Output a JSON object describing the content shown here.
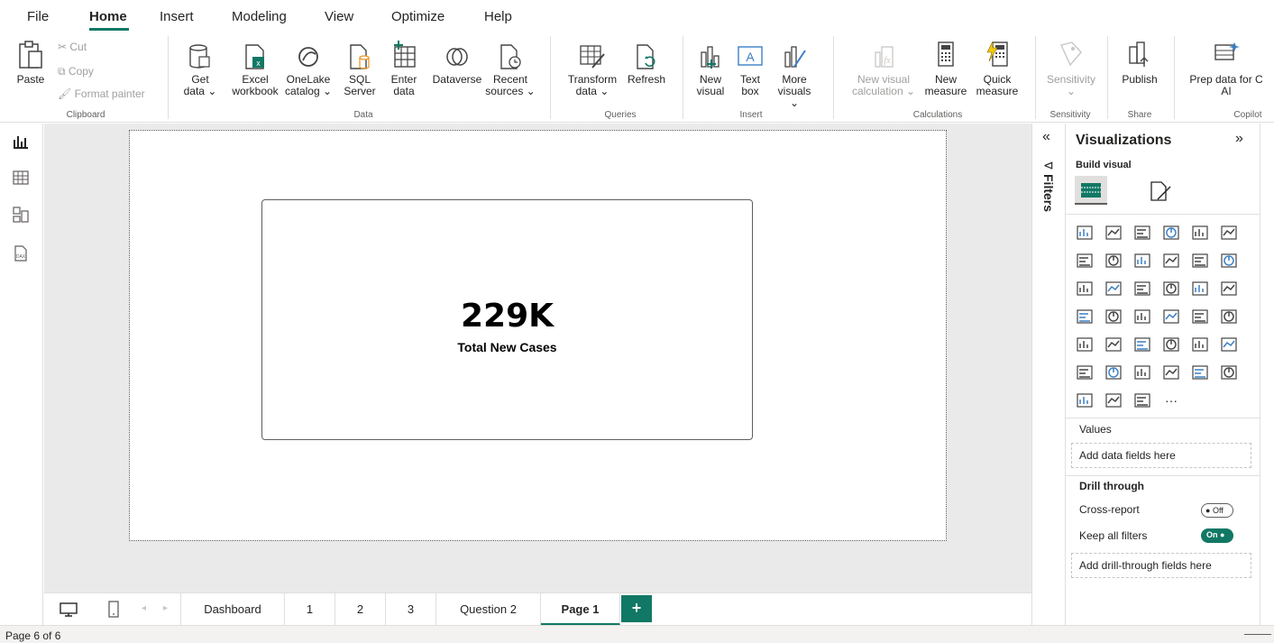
{
  "menu": {
    "items": [
      "File",
      "Home",
      "Insert",
      "Modeling",
      "View",
      "Optimize",
      "Help"
    ],
    "active": "Home"
  },
  "ribbon": {
    "clipboard": {
      "paste": "Paste",
      "cut": "Cut",
      "copy": "Copy",
      "format_painter": "Format painter",
      "group": "Clipboard"
    },
    "data": {
      "group": "Data",
      "get_data": [
        "Get",
        "data ⌄"
      ],
      "excel": [
        "Excel",
        "workbook"
      ],
      "onelake": [
        "OneLake",
        "catalog ⌄"
      ],
      "sql": [
        "SQL",
        "Server"
      ],
      "enter": [
        "Enter",
        "data"
      ],
      "dataverse": [
        "Dataverse",
        ""
      ],
      "recent": [
        "Recent",
        "sources ⌄"
      ]
    },
    "queries": {
      "group": "Queries",
      "transform": [
        "Transform",
        "data ⌄"
      ],
      "refresh": [
        "Refresh",
        ""
      ]
    },
    "insert": {
      "group": "Insert",
      "new_visual": [
        "New",
        "visual"
      ],
      "text_box": [
        "Text",
        "box"
      ],
      "more_visuals": [
        "More",
        "visuals ⌄"
      ]
    },
    "calculations": {
      "group": "Calculations",
      "new_visual_calc": [
        "New visual",
        "calculation ⌄"
      ],
      "new_measure": [
        "New",
        "measure"
      ],
      "quick_measure": [
        "Quick",
        "measure"
      ]
    },
    "sensitivity": {
      "group": "Sensitivity",
      "label": [
        "Sensitivity",
        "⌄"
      ]
    },
    "share": {
      "group": "Share",
      "publish": [
        "Publish",
        ""
      ]
    },
    "copilot": {
      "group": "Copilot",
      "prep": [
        "Prep data for C",
        "AI"
      ]
    }
  },
  "card": {
    "value": "229K",
    "label": "Total New Cases"
  },
  "tabs": [
    "Dashboard",
    "1",
    "2",
    "3",
    "Question 2",
    "Page 1"
  ],
  "active_tab": "Page 1",
  "add_page": "+",
  "status": "Page 6 of 6",
  "filters": {
    "label": "Filters",
    "collapse": "«"
  },
  "visualizations": {
    "title": "Visualizations",
    "expand": "»",
    "build_visual": "Build visual",
    "values_label": "Values",
    "values_placeholder": "Add data fields here",
    "drill_through": "Drill through",
    "cross_report": "Cross-report",
    "cross_report_state": "Off",
    "keep_filters": "Keep all filters",
    "keep_filters_state": "On",
    "drill_placeholder": "Add drill-through fields here",
    "more": "···"
  },
  "colors": {
    "accent": "#117865",
    "highlight": "#f5e51b"
  }
}
